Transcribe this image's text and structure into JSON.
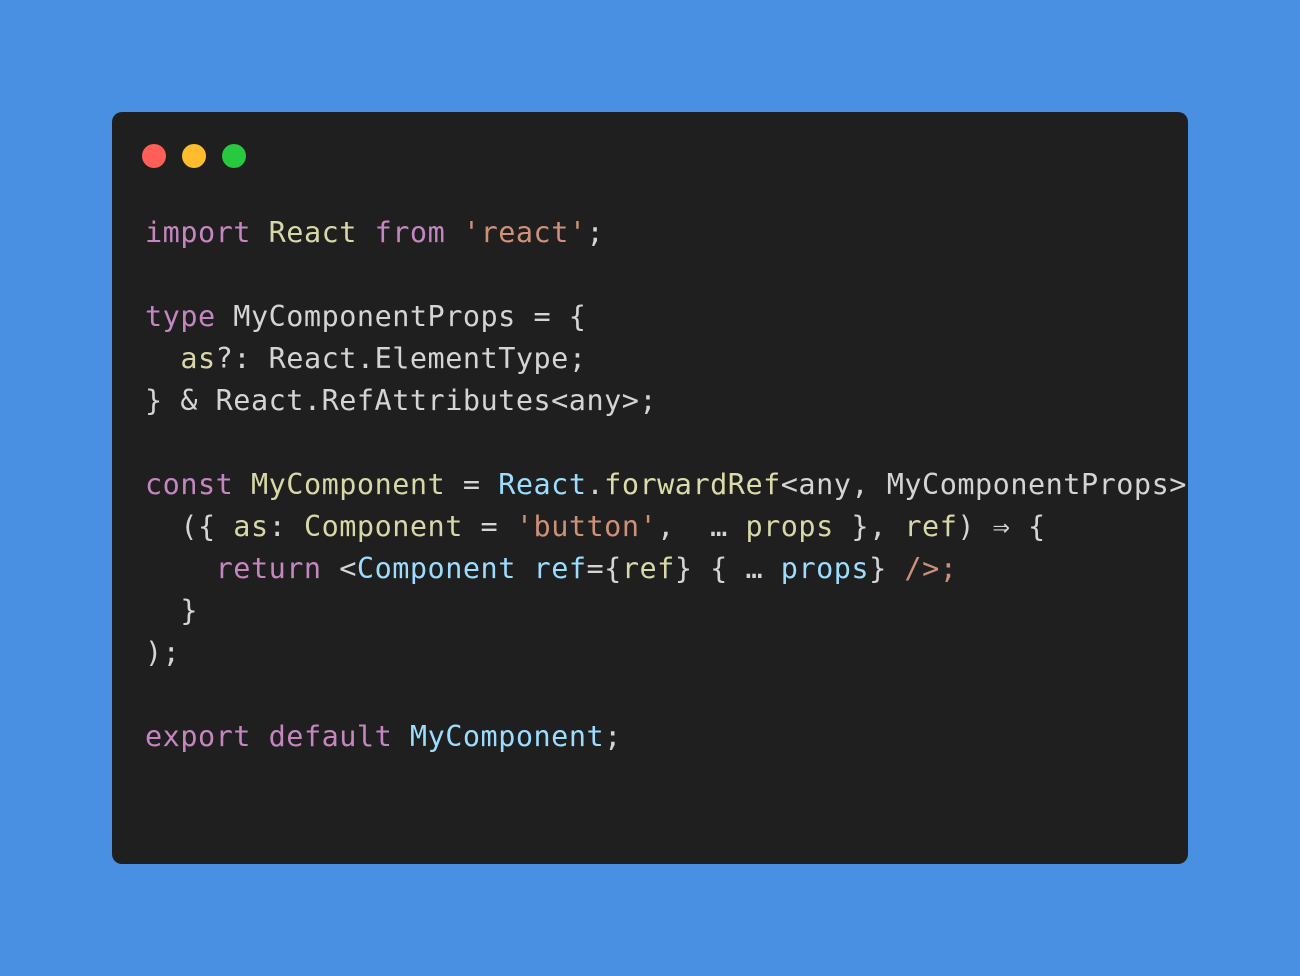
{
  "colors": {
    "background": "#4a90e2",
    "window": "#1f1f1f",
    "dot_red": "#ff5f56",
    "dot_yellow": "#ffbd2e",
    "dot_green": "#27c93f"
  },
  "window": {
    "controls": [
      {
        "name": "close-dot",
        "color": "#ff5f56"
      },
      {
        "name": "minimize-dot",
        "color": "#ffbd2e"
      },
      {
        "name": "maximize-dot",
        "color": "#27c93f"
      }
    ]
  },
  "code": {
    "lines": [
      [
        {
          "t": "kw",
          "v": "import"
        },
        {
          "t": "plain",
          "v": " "
        },
        {
          "t": "type",
          "v": "React"
        },
        {
          "t": "plain",
          "v": " "
        },
        {
          "t": "kw",
          "v": "from"
        },
        {
          "t": "plain",
          "v": " "
        },
        {
          "t": "string",
          "v": "'react'"
        },
        {
          "t": "plain",
          "v": ";"
        }
      ],
      [],
      [
        {
          "t": "kw",
          "v": "type"
        },
        {
          "t": "plain",
          "v": " MyComponentProps = {"
        }
      ],
      [
        {
          "t": "plain",
          "v": "  "
        },
        {
          "t": "type",
          "v": "as"
        },
        {
          "t": "plain",
          "v": "?: React.ElementType;"
        }
      ],
      [
        {
          "t": "plain",
          "v": "} & React.RefAttributes<any>;"
        }
      ],
      [],
      [
        {
          "t": "kw",
          "v": "const"
        },
        {
          "t": "plain",
          "v": " "
        },
        {
          "t": "type",
          "v": "MyComponent"
        },
        {
          "t": "plain",
          "v": " = "
        },
        {
          "t": "var",
          "v": "React"
        },
        {
          "t": "plain",
          "v": "."
        },
        {
          "t": "fn",
          "v": "forwardRef"
        },
        {
          "t": "plain",
          "v": "<any, MyComponentProps>("
        }
      ],
      [
        {
          "t": "plain",
          "v": "  ({ "
        },
        {
          "t": "type",
          "v": "as"
        },
        {
          "t": "plain",
          "v": ": "
        },
        {
          "t": "type",
          "v": "Component"
        },
        {
          "t": "plain",
          "v": " = "
        },
        {
          "t": "string",
          "v": "'button'"
        },
        {
          "t": "plain",
          "v": ",  … "
        },
        {
          "t": "type",
          "v": "props"
        },
        {
          "t": "plain",
          "v": " }, "
        },
        {
          "t": "type",
          "v": "ref"
        },
        {
          "t": "plain",
          "v": ") ⇒ {"
        }
      ],
      [
        {
          "t": "plain",
          "v": "    "
        },
        {
          "t": "kw",
          "v": "return"
        },
        {
          "t": "plain",
          "v": " <"
        },
        {
          "t": "var",
          "v": "Component"
        },
        {
          "t": "plain",
          "v": " "
        },
        {
          "t": "var",
          "v": "ref"
        },
        {
          "t": "plain",
          "v": "={"
        },
        {
          "t": "type",
          "v": "ref"
        },
        {
          "t": "plain",
          "v": "} { … "
        },
        {
          "t": "var",
          "v": "props"
        },
        {
          "t": "plain",
          "v": "} "
        },
        {
          "t": "jsx",
          "v": "/>;"
        }
      ],
      [
        {
          "t": "plain",
          "v": "  }"
        }
      ],
      [
        {
          "t": "plain",
          "v": ");"
        }
      ],
      [],
      [
        {
          "t": "kw",
          "v": "export"
        },
        {
          "t": "plain",
          "v": " "
        },
        {
          "t": "kw",
          "v": "default"
        },
        {
          "t": "plain",
          "v": " "
        },
        {
          "t": "var",
          "v": "MyComponent"
        },
        {
          "t": "plain",
          "v": ";"
        }
      ]
    ]
  }
}
